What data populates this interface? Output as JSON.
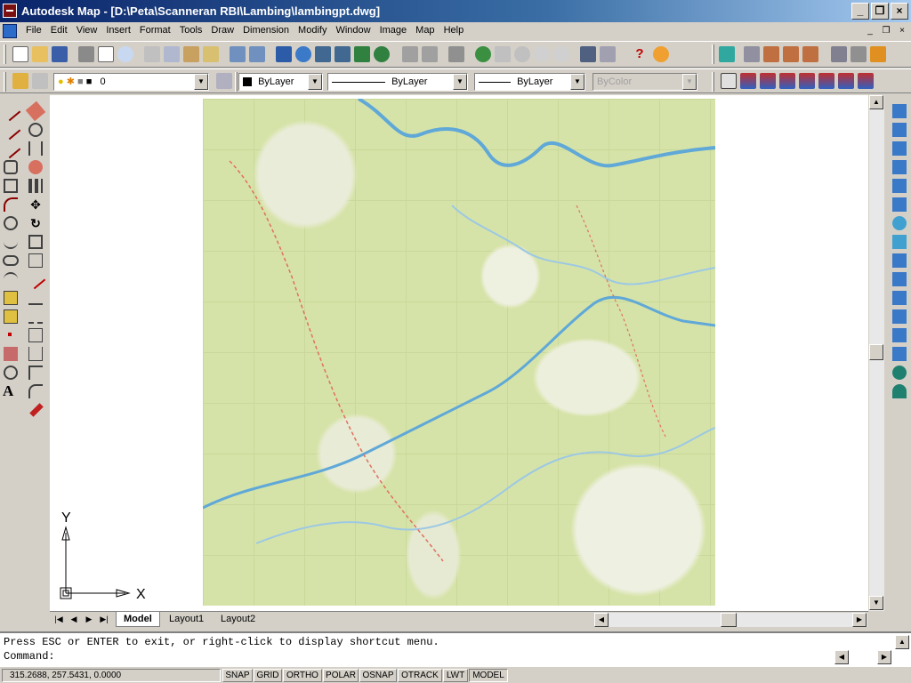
{
  "window": {
    "title": "Autodesk Map - [D:\\Peta\\Scanneran RBI\\Lambing\\lambingpt.dwg]",
    "minimize_glyph": "_",
    "restore_glyph": "❐",
    "close_glyph": "×"
  },
  "menu": [
    "File",
    "Edit",
    "View",
    "Insert",
    "Format",
    "Tools",
    "Draw",
    "Dimension",
    "Modify",
    "Window",
    "Image",
    "Map",
    "Help"
  ],
  "layer_combo": {
    "value": "0"
  },
  "properties": {
    "color": "ByLayer",
    "linetype": "ByLayer",
    "lineweight": "ByLayer",
    "plotstyle": "ByColor"
  },
  "ucs": {
    "x_label": "X",
    "y_label": "Y"
  },
  "tabs": {
    "model": "Model",
    "layout1": "Layout1",
    "layout2": "Layout2"
  },
  "command": {
    "history": "Press ESC or ENTER to exit, or right-click to display shortcut menu.",
    "prompt": "Command:"
  },
  "status": {
    "coords": "315.2688, 257.5431, 0.0000",
    "toggles": [
      "SNAP",
      "GRID",
      "ORTHO",
      "POLAR",
      "OSNAP",
      "OTRACK",
      "LWT",
      "MODEL"
    ]
  },
  "colors": {
    "title_bar": "#0a246a",
    "map_base": "#d6e3a8",
    "river": "#5fa8d8",
    "road": "#e07060"
  }
}
